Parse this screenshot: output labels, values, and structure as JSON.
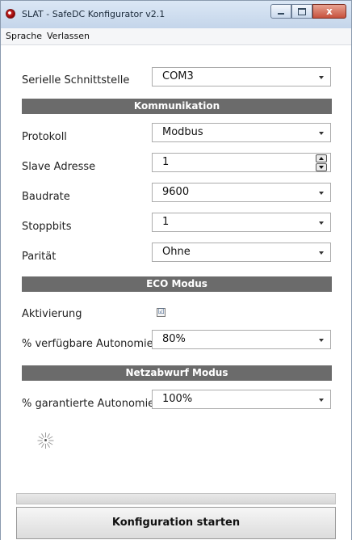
{
  "window": {
    "title": "SLAT - SafeDC Konfigurator v2.1",
    "close_glyph": "x"
  },
  "menu": [
    "Sprache",
    "Verlassen"
  ],
  "serial": {
    "label": "Serielle Schnittstelle",
    "value": "COM3"
  },
  "communication": {
    "header": "Kommunikation",
    "protocol": {
      "label": "Protokoll",
      "value": "Modbus"
    },
    "slave": {
      "label": "Slave Adresse",
      "value": "1"
    },
    "baud": {
      "label": "Baudrate",
      "value": "9600"
    },
    "stopbits": {
      "label": "Stoppbits",
      "value": "1"
    },
    "parity": {
      "label": "Parität",
      "value": "Ohne"
    }
  },
  "eco": {
    "header": "ECO Modus",
    "activation": {
      "label": "Aktivierung",
      "checked": true,
      "check_glyph": "☑"
    },
    "autonomy": {
      "label": "% verfügbare Autonomie",
      "value": "80%"
    }
  },
  "netz": {
    "header": "Netzabwurf Modus",
    "autonomy": {
      "label": "% garantierte Autonomie",
      "value": "100%"
    }
  },
  "start_button": "Konfiguration starten",
  "icons": {
    "app": "app-icon",
    "dropdown": "chevron-down-icon",
    "busy": "loading-spinner-icon"
  }
}
